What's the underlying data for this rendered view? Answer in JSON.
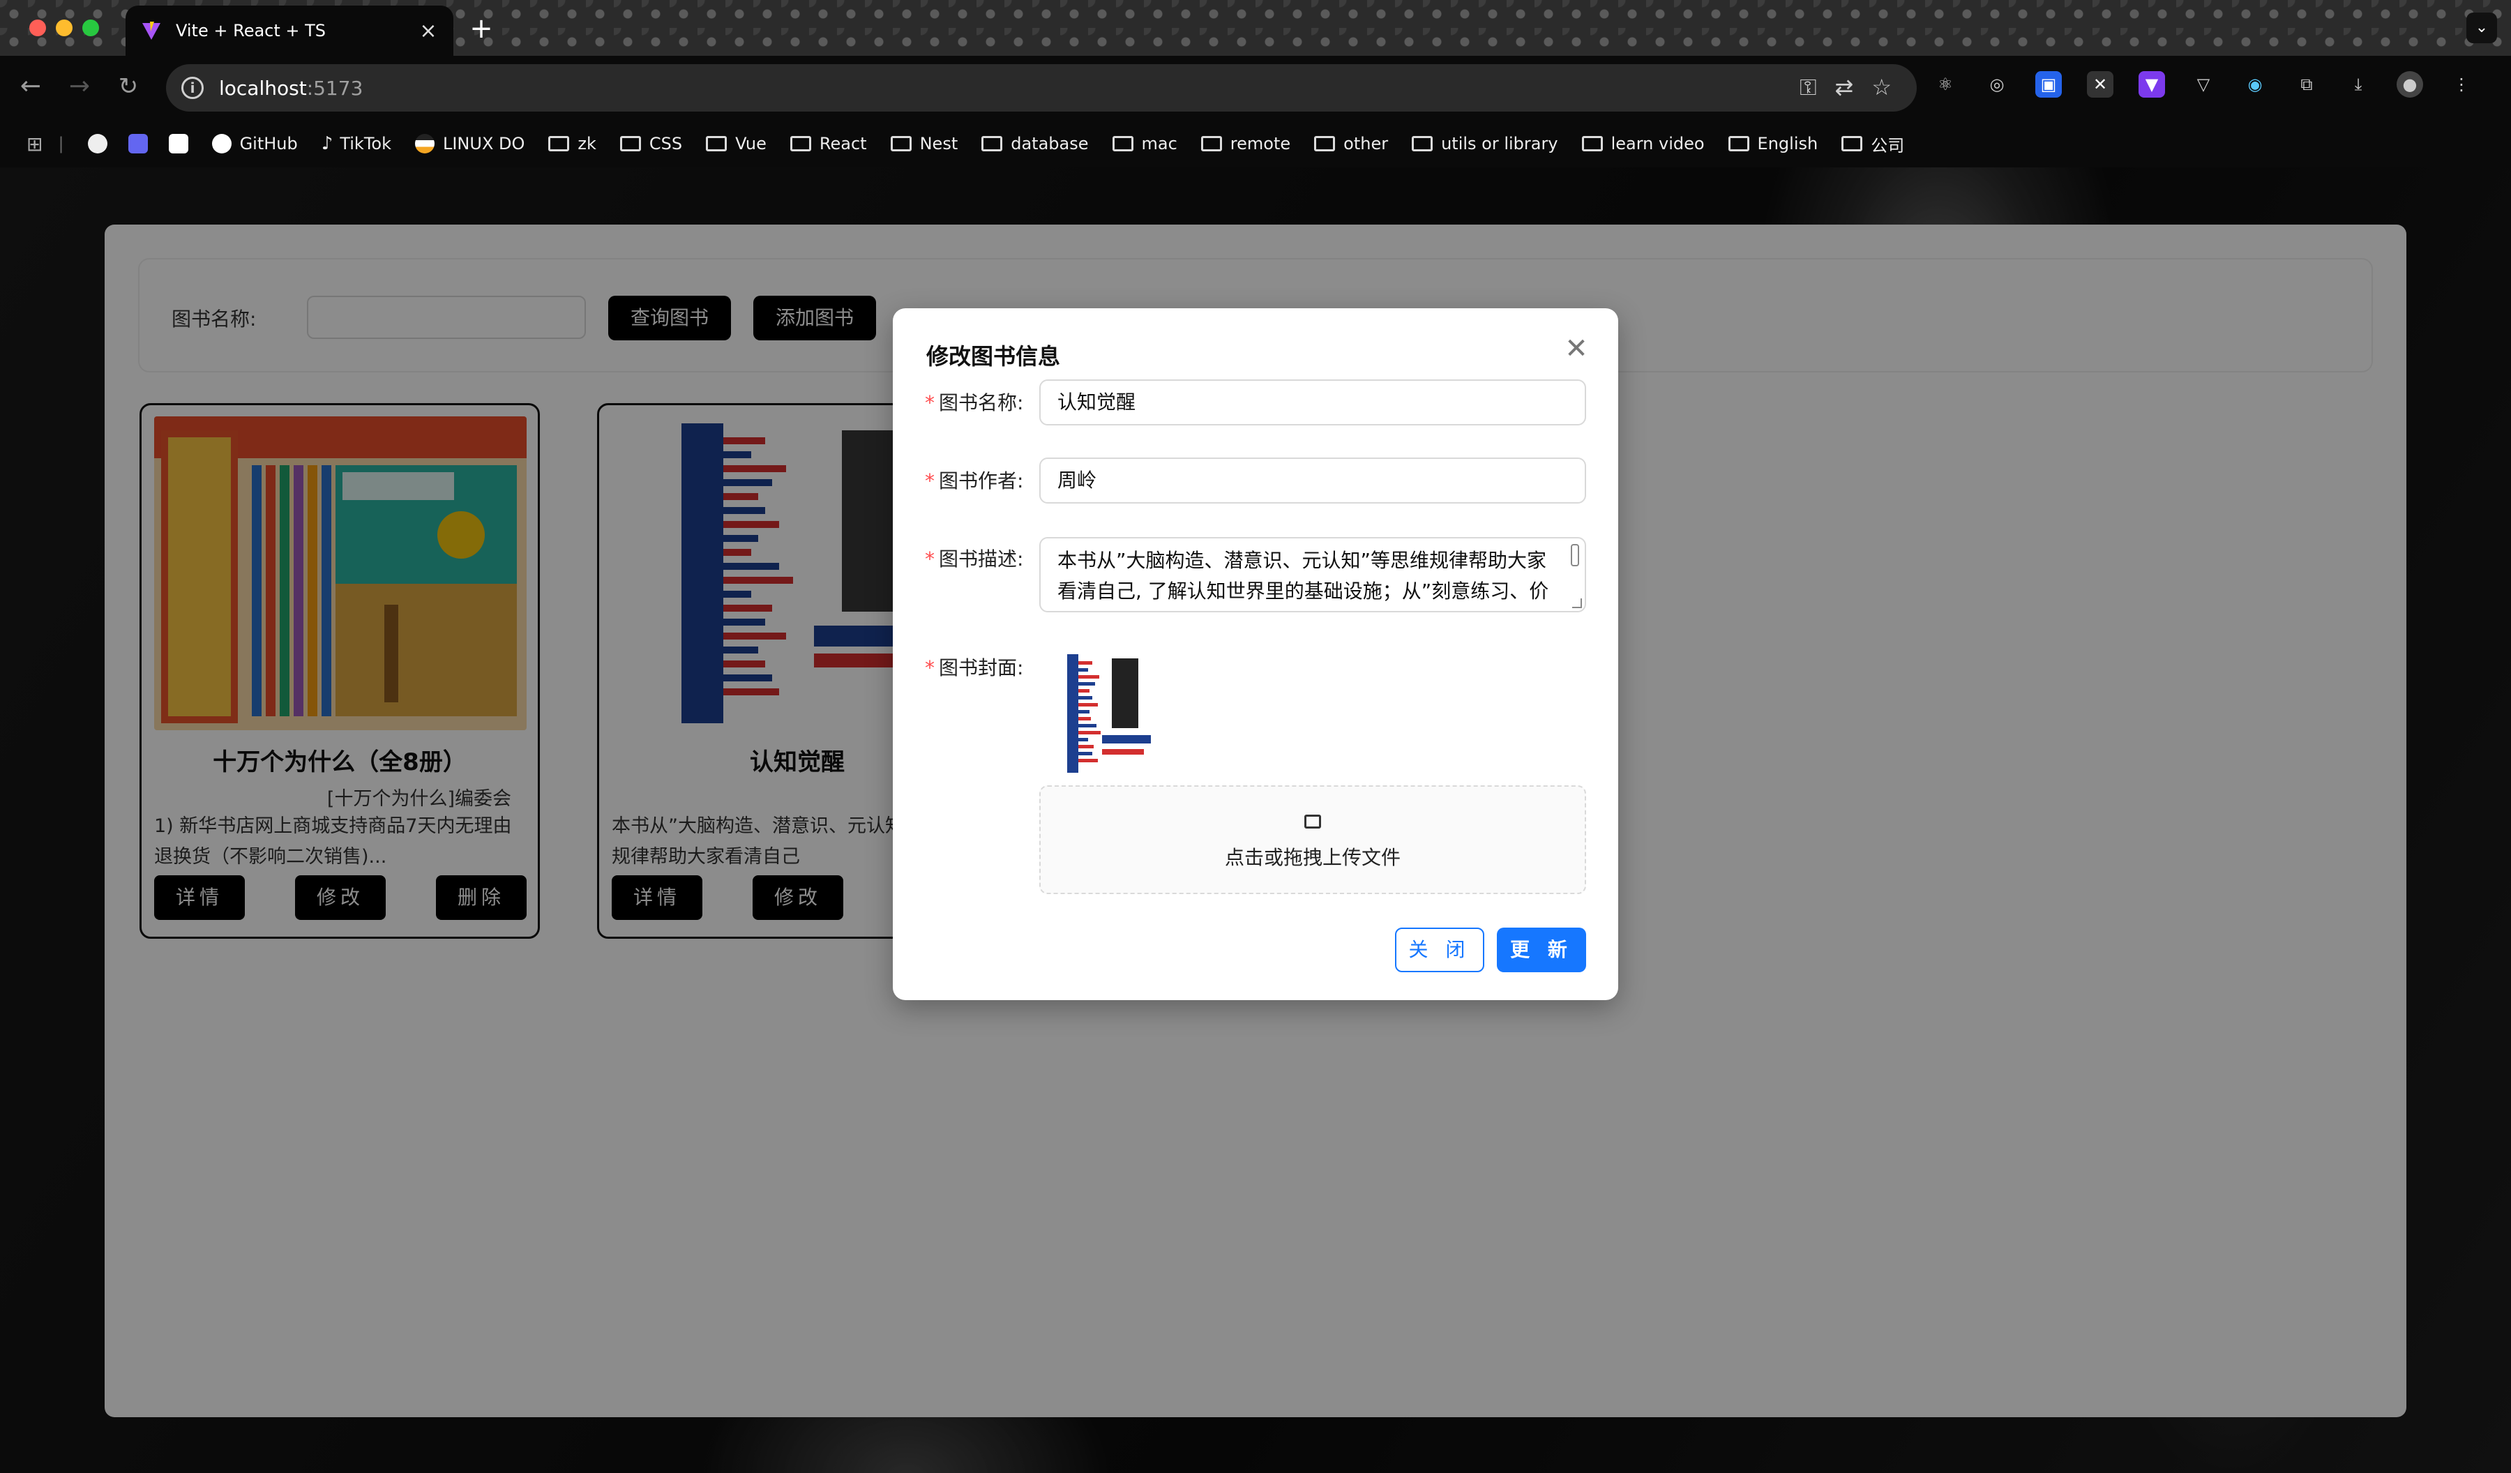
{
  "browser": {
    "tab_title": "Vite + React + TS",
    "url_host": "localhost",
    "url_port": ":5173",
    "bookmarks": [
      "GitHub",
      "TikTok",
      "LINUX DO",
      "zk",
      "CSS",
      "Vue",
      "React",
      "Nest",
      "database",
      "mac",
      "remote",
      "other",
      "utils or library",
      "learn video",
      "English",
      "公司"
    ]
  },
  "search": {
    "label": "图书名称:",
    "query_button": "查询图书",
    "add_button": "添加图书"
  },
  "books": [
    {
      "title": "十万个为什么（全8册）",
      "author": "[十万个为什么]编委会",
      "description": "1) 新华书店网上商城支持商品7天内无理由退换货（不影响二次销售)...",
      "actions": [
        "详情",
        "修改",
        "删除"
      ]
    },
    {
      "title": "认知觉醒",
      "description": "本书从”大脑构造、潜意识、元认知”等思维规律帮助大家看清自己",
      "actions": [
        "详情",
        "修改"
      ]
    }
  ],
  "modal": {
    "title": "修改图书信息",
    "name_label": "图书名称:",
    "name_value": "认知觉醒",
    "author_label": "图书作者:",
    "author_value": "周岭",
    "desc_label": "图书描述:",
    "desc_value": "本书从”大脑构造、潜意识、元认知”等思维规律帮助大家看清自己, 了解认知世界里的基础设施；从”刻意练习、价",
    "cover_label": "图书封面:",
    "upload_text": "点击或拖拽上传文件",
    "close_button": "关 闭",
    "update_button": "更 新"
  },
  "colors": {
    "primary": "#1677ff",
    "required": "#ff4d4f"
  }
}
